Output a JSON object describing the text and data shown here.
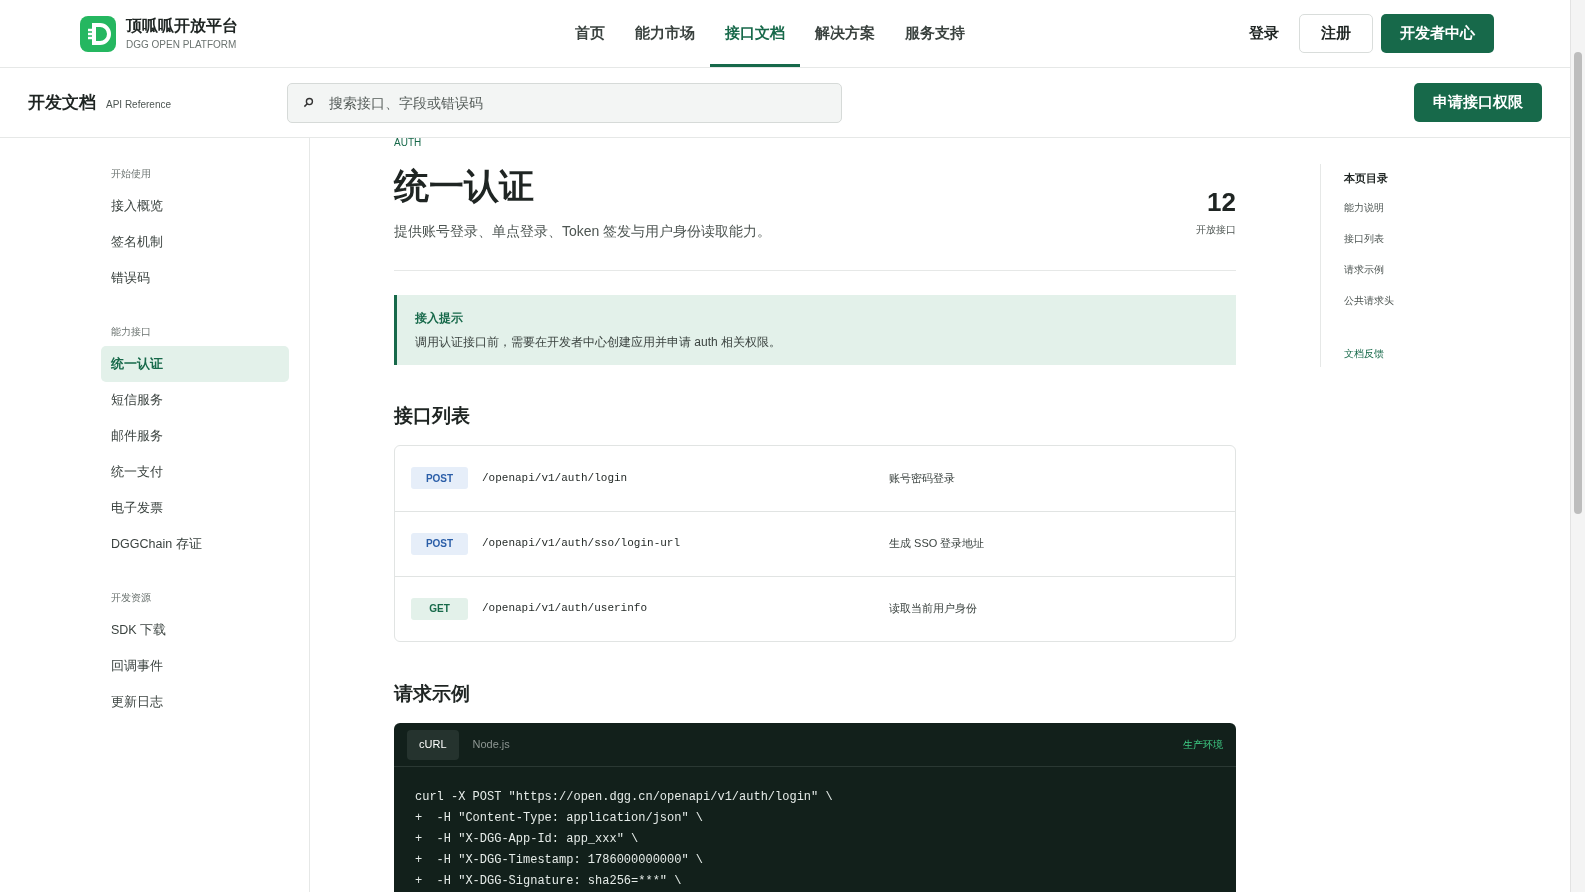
{
  "brand": {
    "name": "顶呱呱开放平台",
    "subtitle": "DGG OPEN PLATFORM"
  },
  "nav": [
    {
      "label": "首页",
      "selected": false
    },
    {
      "label": "能力市场",
      "selected": false
    },
    {
      "label": "接口文档",
      "selected": true
    },
    {
      "label": "解决方案",
      "selected": false
    },
    {
      "label": "服务支持",
      "selected": false
    }
  ],
  "header_actions": {
    "login": "登录",
    "register": "注册",
    "developer_center": "开发者中心"
  },
  "subheader": {
    "title": "开发文档",
    "subtitle": "API Reference",
    "search": {
      "placeholder": "搜索接口、字段或错误码"
    },
    "apply_button": "申请接口权限"
  },
  "sidebar": {
    "groups": [
      {
        "label": "开始使用",
        "items": [
          {
            "label": "接入概览",
            "selected": false
          },
          {
            "label": "签名机制",
            "selected": false
          },
          {
            "label": "错误码",
            "selected": false
          }
        ]
      },
      {
        "label": "能力接口",
        "items": [
          {
            "label": "统一认证",
            "selected": true
          },
          {
            "label": "短信服务",
            "selected": false
          },
          {
            "label": "邮件服务",
            "selected": false
          },
          {
            "label": "统一支付",
            "selected": false
          },
          {
            "label": "电子发票",
            "selected": false
          },
          {
            "label": "DGGChain 存证",
            "selected": false
          }
        ]
      },
      {
        "label": "开发资源",
        "items": [
          {
            "label": "SDK 下载",
            "selected": false
          },
          {
            "label": "回调事件",
            "selected": false
          },
          {
            "label": "更新日志",
            "selected": false
          }
        ]
      }
    ]
  },
  "page": {
    "eyebrow": "AUTH",
    "title": "统一认证",
    "description": "提供账号登录、单点登录、Token 签发与用户身份读取能力。",
    "stat": {
      "value": "12",
      "label": "开放接口"
    },
    "notice": {
      "title": "接入提示",
      "text": "调用认证接口前，需要在开发者中心创建应用并申请 auth 相关权限。"
    },
    "endpoints_title": "接口列表",
    "endpoints": [
      {
        "method": "POST",
        "kind": "post",
        "path": "/openapi/v1/auth/login",
        "description": "账号密码登录"
      },
      {
        "method": "POST",
        "kind": "post",
        "path": "/openapi/v1/auth/sso/login-url",
        "description": "生成 SSO 登录地址"
      },
      {
        "method": "GET",
        "kind": "get",
        "path": "/openapi/v1/auth/userinfo",
        "description": "读取当前用户身份"
      }
    ],
    "example_title": "请求示例",
    "code": {
      "tabs": [
        {
          "label": "cURL",
          "selected": true
        },
        {
          "label": "Node.js",
          "selected": false
        }
      ],
      "environment": "生产环境",
      "lines": [
        "curl -X POST \"https://open.dgg.cn/openapi/v1/auth/login\" \\",
        "+  -H \"Content-Type: application/json\" \\",
        "+  -H \"X-DGG-App-Id: app_xxx\" \\",
        "+  -H \"X-DGG-Timestamp: 1786000000000\" \\",
        "+  -H \"X-DGG-Signature: sha256=***\" \\"
      ]
    }
  },
  "toc": {
    "title": "本页目录",
    "items": [
      "能力说明",
      "接口列表",
      "请求示例",
      "公共请求头"
    ],
    "feedback": "文档反馈"
  }
}
